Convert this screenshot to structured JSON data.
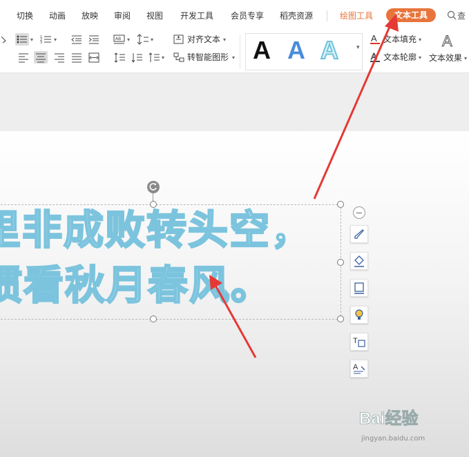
{
  "tabs": [
    {
      "label": "切换",
      "style": "normal"
    },
    {
      "label": "动画",
      "style": "normal"
    },
    {
      "label": "放映",
      "style": "normal"
    },
    {
      "label": "审阅",
      "style": "normal"
    },
    {
      "label": "视图",
      "style": "normal"
    },
    {
      "label": "开发工具",
      "style": "normal"
    },
    {
      "label": "会员专享",
      "style": "normal"
    },
    {
      "label": "稻壳资源",
      "style": "normal"
    },
    {
      "label": "绘图工具",
      "style": "contextual"
    },
    {
      "label": "文本工具",
      "style": "active"
    },
    {
      "label": "查",
      "style": "search"
    }
  ],
  "ribbon": {
    "align_text": "对齐文本",
    "smart_shape": "转智能图形",
    "text_fill": "文本填充",
    "text_outline": "文本轮廓",
    "text_effect": "文本效果",
    "style_samples": [
      "A",
      "A",
      "A"
    ]
  },
  "slide": {
    "line1": "里非成败转头空，",
    "line2": "惯看秋月春风。"
  },
  "watermark": {
    "logo": "Bai经验",
    "url": "jingyan.baidu.com"
  },
  "colors": {
    "accent": "#e8743b",
    "annotation_arrow": "#e53935",
    "text_outline": "#7cc4de"
  }
}
